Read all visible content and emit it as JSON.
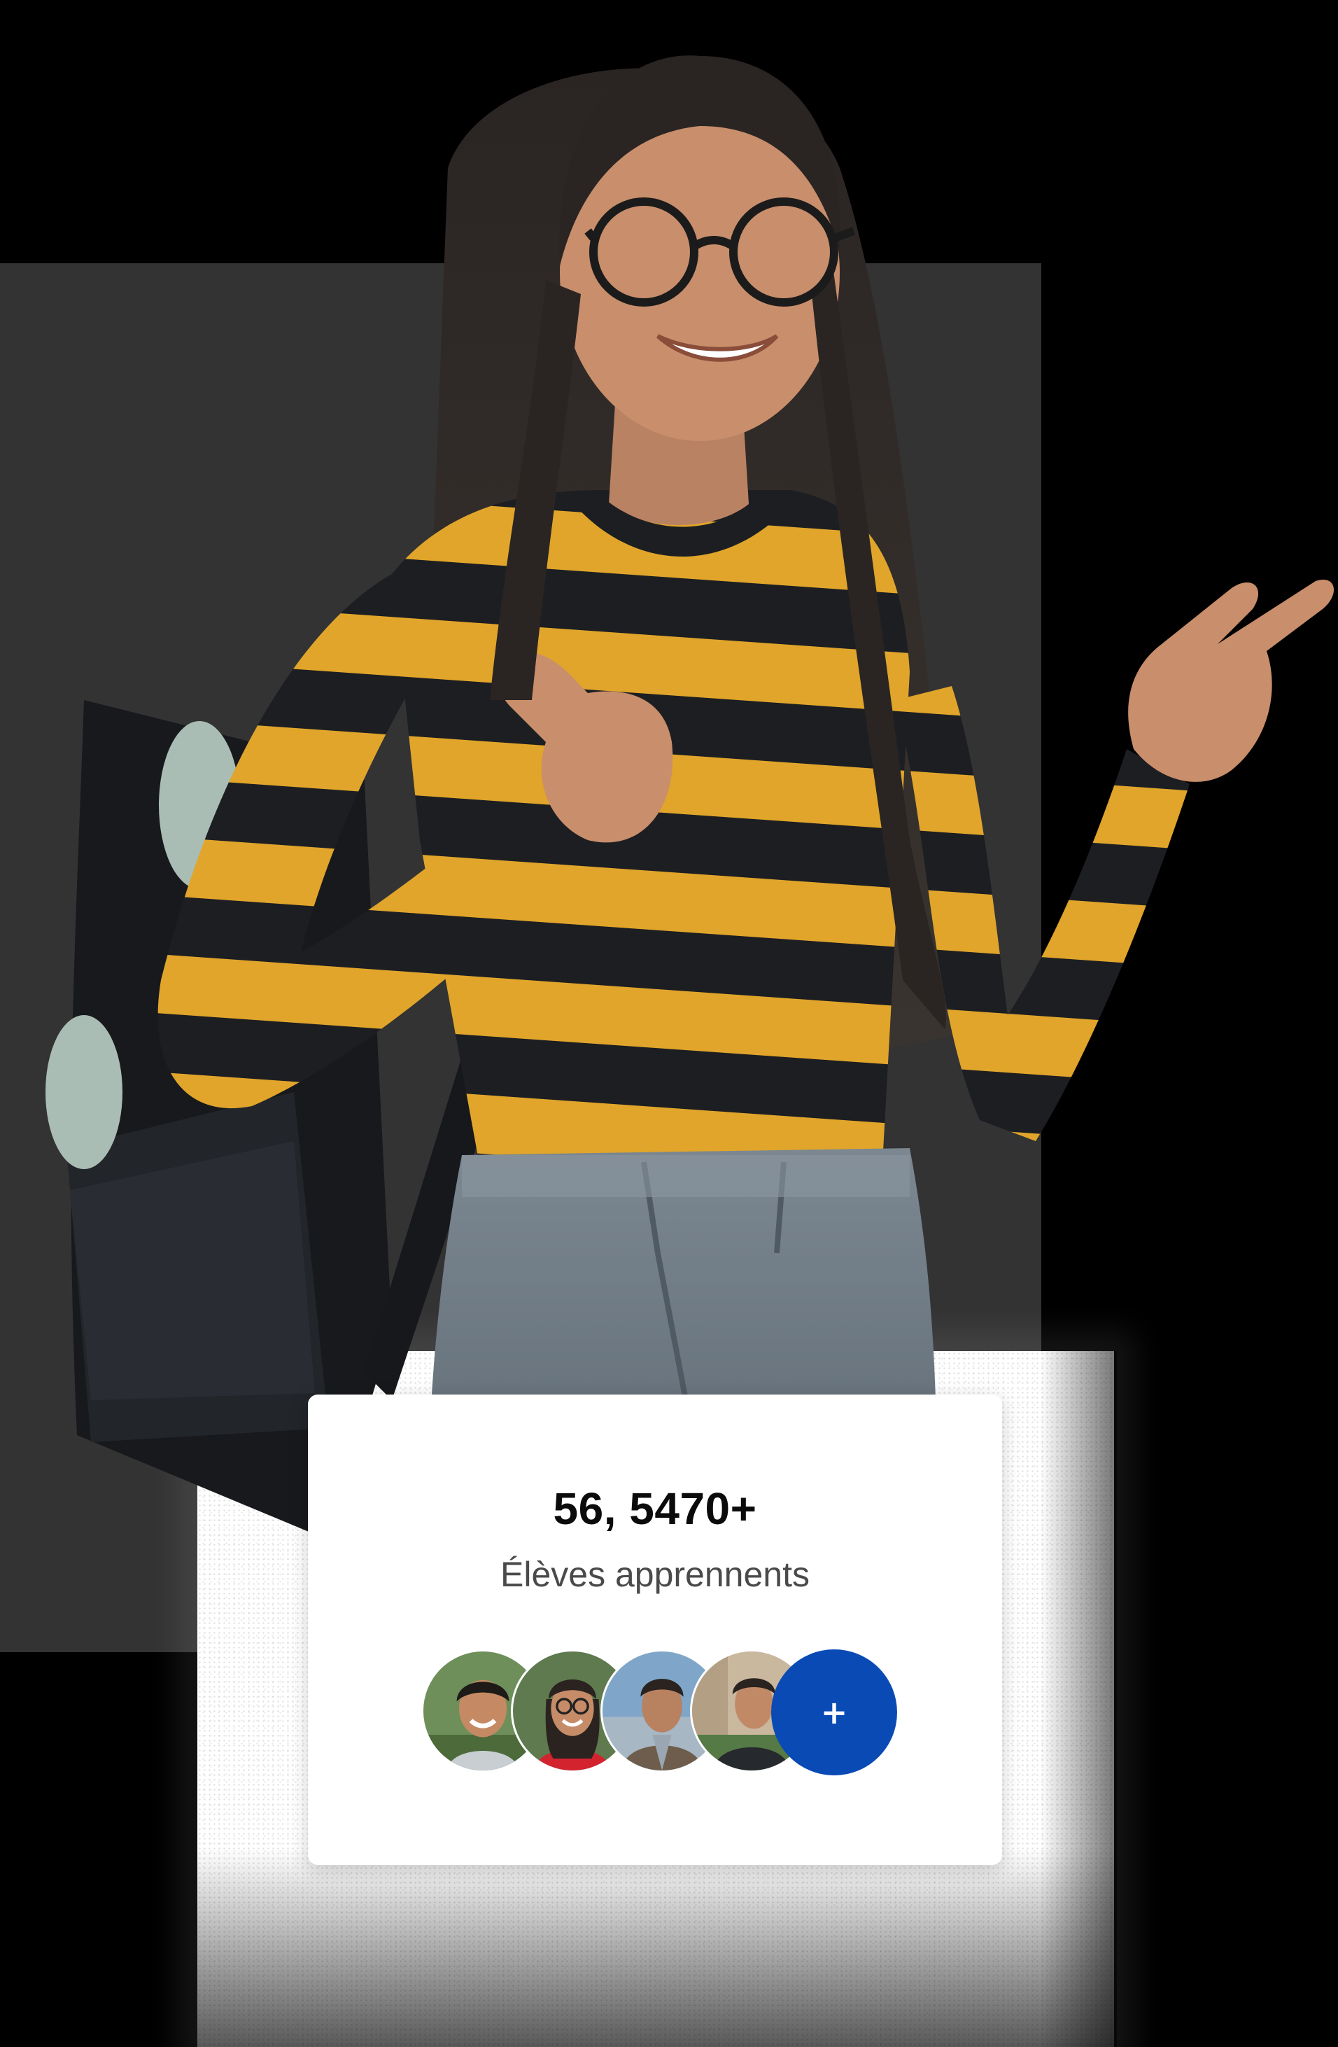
{
  "colors": {
    "background": "#000000",
    "panel": "#333333",
    "card": "#ffffff",
    "accent": "#0a4ab5",
    "sweater_yellow": "#e0a52a",
    "sweater_black": "#1c1e22",
    "pants_gray": "#6b7680"
  },
  "stats": {
    "count": "56, 5470+",
    "label": "Élèves apprennents"
  },
  "avatars": [
    {
      "icon": "student-avatar-icon"
    },
    {
      "icon": "student-avatar-icon"
    },
    {
      "icon": "student-avatar-icon"
    },
    {
      "icon": "student-avatar-icon"
    }
  ],
  "add_button": {
    "label": "+",
    "icon": "plus-icon"
  }
}
